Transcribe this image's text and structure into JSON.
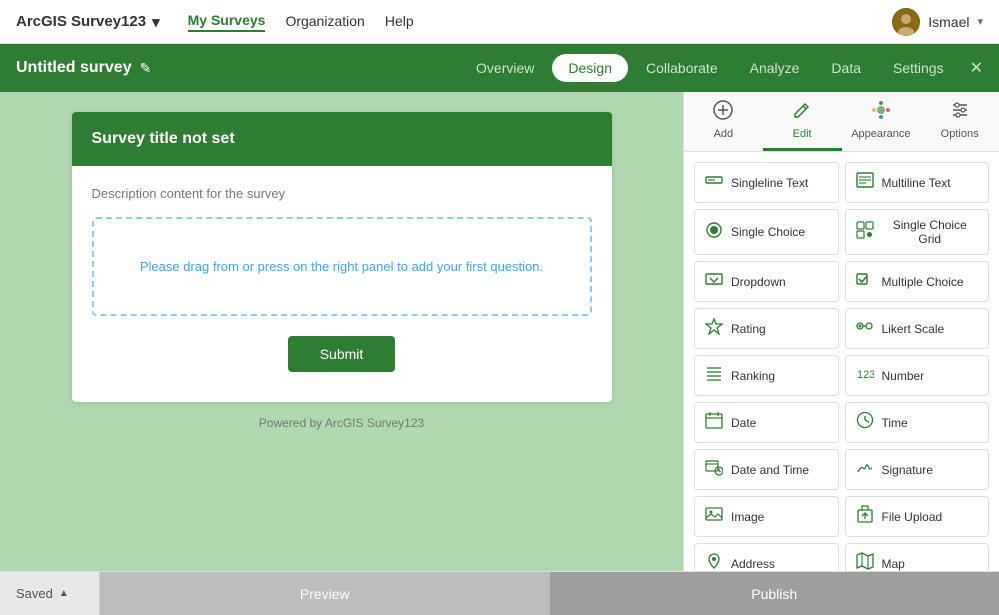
{
  "app": {
    "brand": "ArcGIS Survey123",
    "brand_dropdown_arrow": "▾",
    "nav_links": [
      {
        "label": "My Surveys",
        "active": true
      },
      {
        "label": "Organization",
        "active": false
      },
      {
        "label": "Help",
        "active": false
      }
    ],
    "user_name": "Ismael",
    "user_dropdown": "▾"
  },
  "sub_nav": {
    "title": "Untitled survey",
    "edit_icon": "✎",
    "links": [
      {
        "label": "Overview",
        "active": false
      },
      {
        "label": "Design",
        "active": true
      },
      {
        "label": "Collaborate",
        "active": false
      },
      {
        "label": "Analyze",
        "active": false
      },
      {
        "label": "Data",
        "active": false
      },
      {
        "label": "Settings",
        "active": false
      }
    ],
    "settings_icon": "✕"
  },
  "survey": {
    "title": "Survey title not set",
    "description": "Description content for the survey",
    "drop_zone_text": "Please drag from or press on the right panel to add your first question.",
    "submit_label": "Submit",
    "powered_by": "Powered by ArcGIS Survey123"
  },
  "panel": {
    "tabs": [
      {
        "label": "Add",
        "icon": "⊕",
        "active": false
      },
      {
        "label": "Edit",
        "icon": "✎",
        "active": true
      },
      {
        "label": "Appearance",
        "icon": "🎨",
        "active": false
      },
      {
        "label": "Options",
        "icon": "≡",
        "active": false
      }
    ],
    "question_types": [
      {
        "icon": "▭",
        "label": "Singleline Text"
      },
      {
        "icon": "≡",
        "label": "Multiline Text"
      },
      {
        "icon": "◉",
        "label": "Single Choice"
      },
      {
        "icon": "⊞",
        "label": "Single Choice Grid"
      },
      {
        "icon": "▽",
        "label": "Dropdown"
      },
      {
        "icon": "☑",
        "label": "Multiple Choice"
      },
      {
        "icon": "☆",
        "label": "Rating"
      },
      {
        "icon": "◦•",
        "label": "Likert Scale"
      },
      {
        "icon": "☰",
        "label": "Ranking"
      },
      {
        "icon": "123",
        "label": "Number"
      },
      {
        "icon": "📅",
        "label": "Date"
      },
      {
        "icon": "⏱",
        "label": "Time"
      },
      {
        "icon": "📅+",
        "label": "Date and Time"
      },
      {
        "icon": "✍",
        "label": "Signature"
      },
      {
        "icon": "🖼",
        "label": "Image"
      },
      {
        "icon": "📁",
        "label": "File Upload"
      },
      {
        "icon": "📍",
        "label": "Address"
      },
      {
        "icon": "🗺",
        "label": "Map"
      }
    ]
  },
  "bottom_bar": {
    "saved_label": "Saved",
    "saved_arrow": "▲",
    "preview_label": "Preview",
    "publish_label": "Publish"
  },
  "colors": {
    "brand_green": "#2e7d32",
    "light_green_bg": "#b2d8b2",
    "link_blue": "#42a5f5"
  }
}
